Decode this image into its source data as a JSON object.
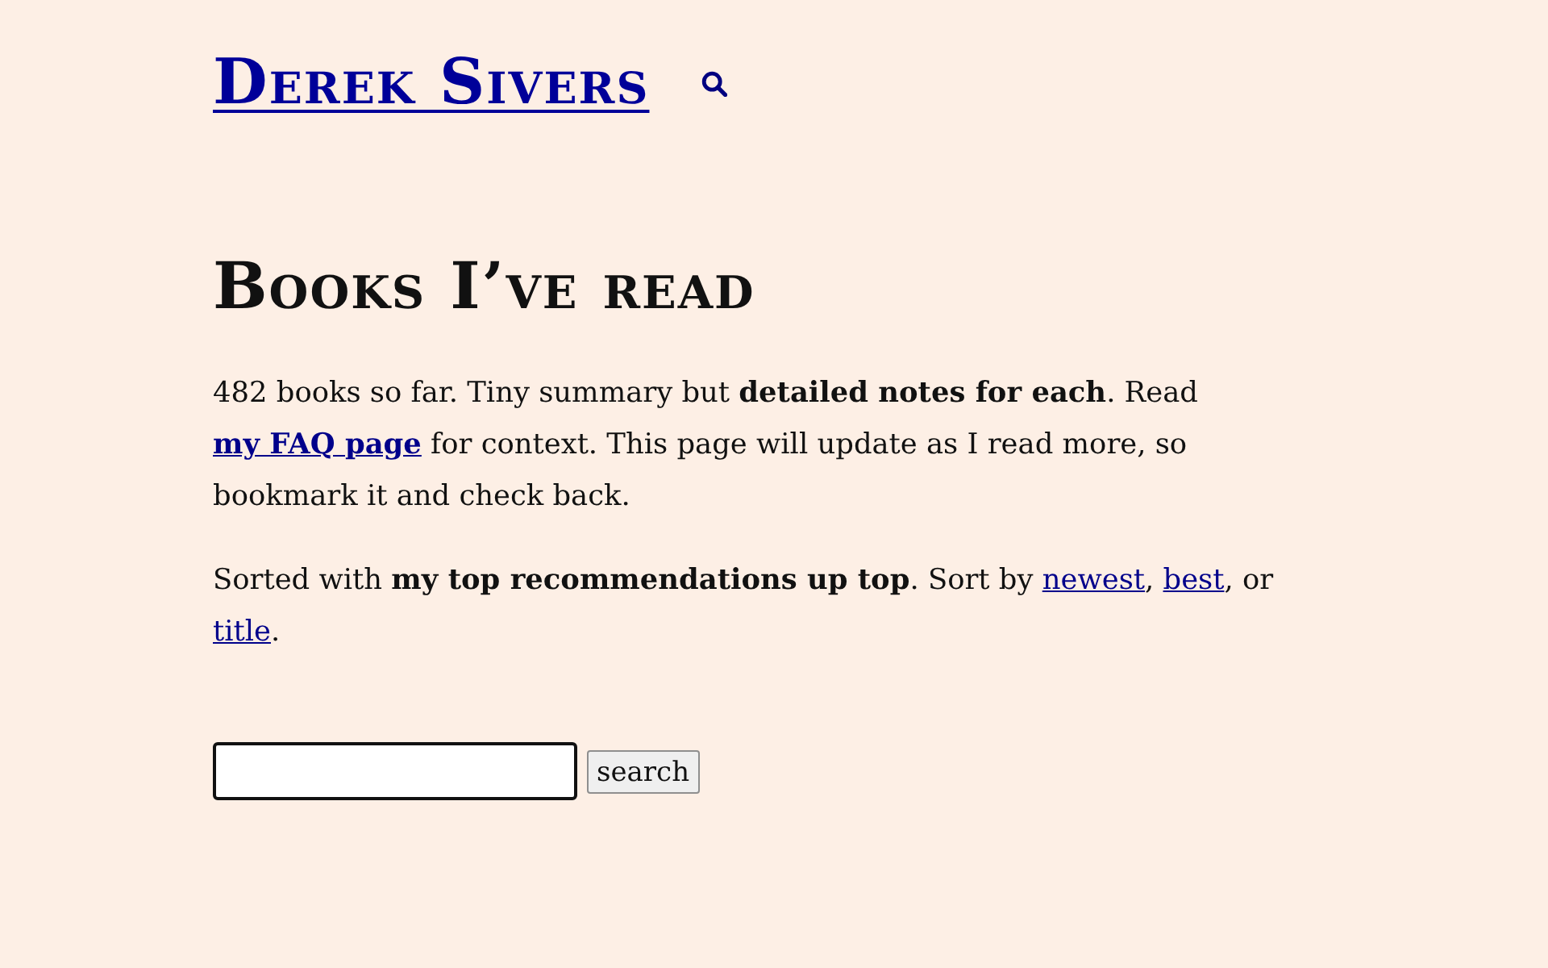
{
  "site_title": "Derek Sivers",
  "heading": "Books I’ve read",
  "paragraphs": [
    {
      "parts": [
        {
          "kind": "text",
          "text": "482 books so far. Tiny summary but **detailed notes for each**. Read "
        },
        {
          "kind": "link",
          "text": "my FAQ page",
          "bold": true
        },
        {
          "kind": "text",
          "text": " for context. This page will update as I read more, so bookmark it and check back."
        }
      ]
    },
    {
      "parts": [
        {
          "kind": "text",
          "text": "Sorted with **my top recommendations up top**. Sort by "
        },
        {
          "kind": "link",
          "text": "newest",
          "bold": false
        },
        {
          "kind": "text",
          "text": ", "
        },
        {
          "kind": "link",
          "text": "best",
          "bold": false
        },
        {
          "kind": "text",
          "text": ", or "
        },
        {
          "kind": "link",
          "text": "title",
          "bold": false
        },
        {
          "kind": "text",
          "text": "."
        }
      ]
    }
  ],
  "search_form": {
    "button": "search"
  }
}
